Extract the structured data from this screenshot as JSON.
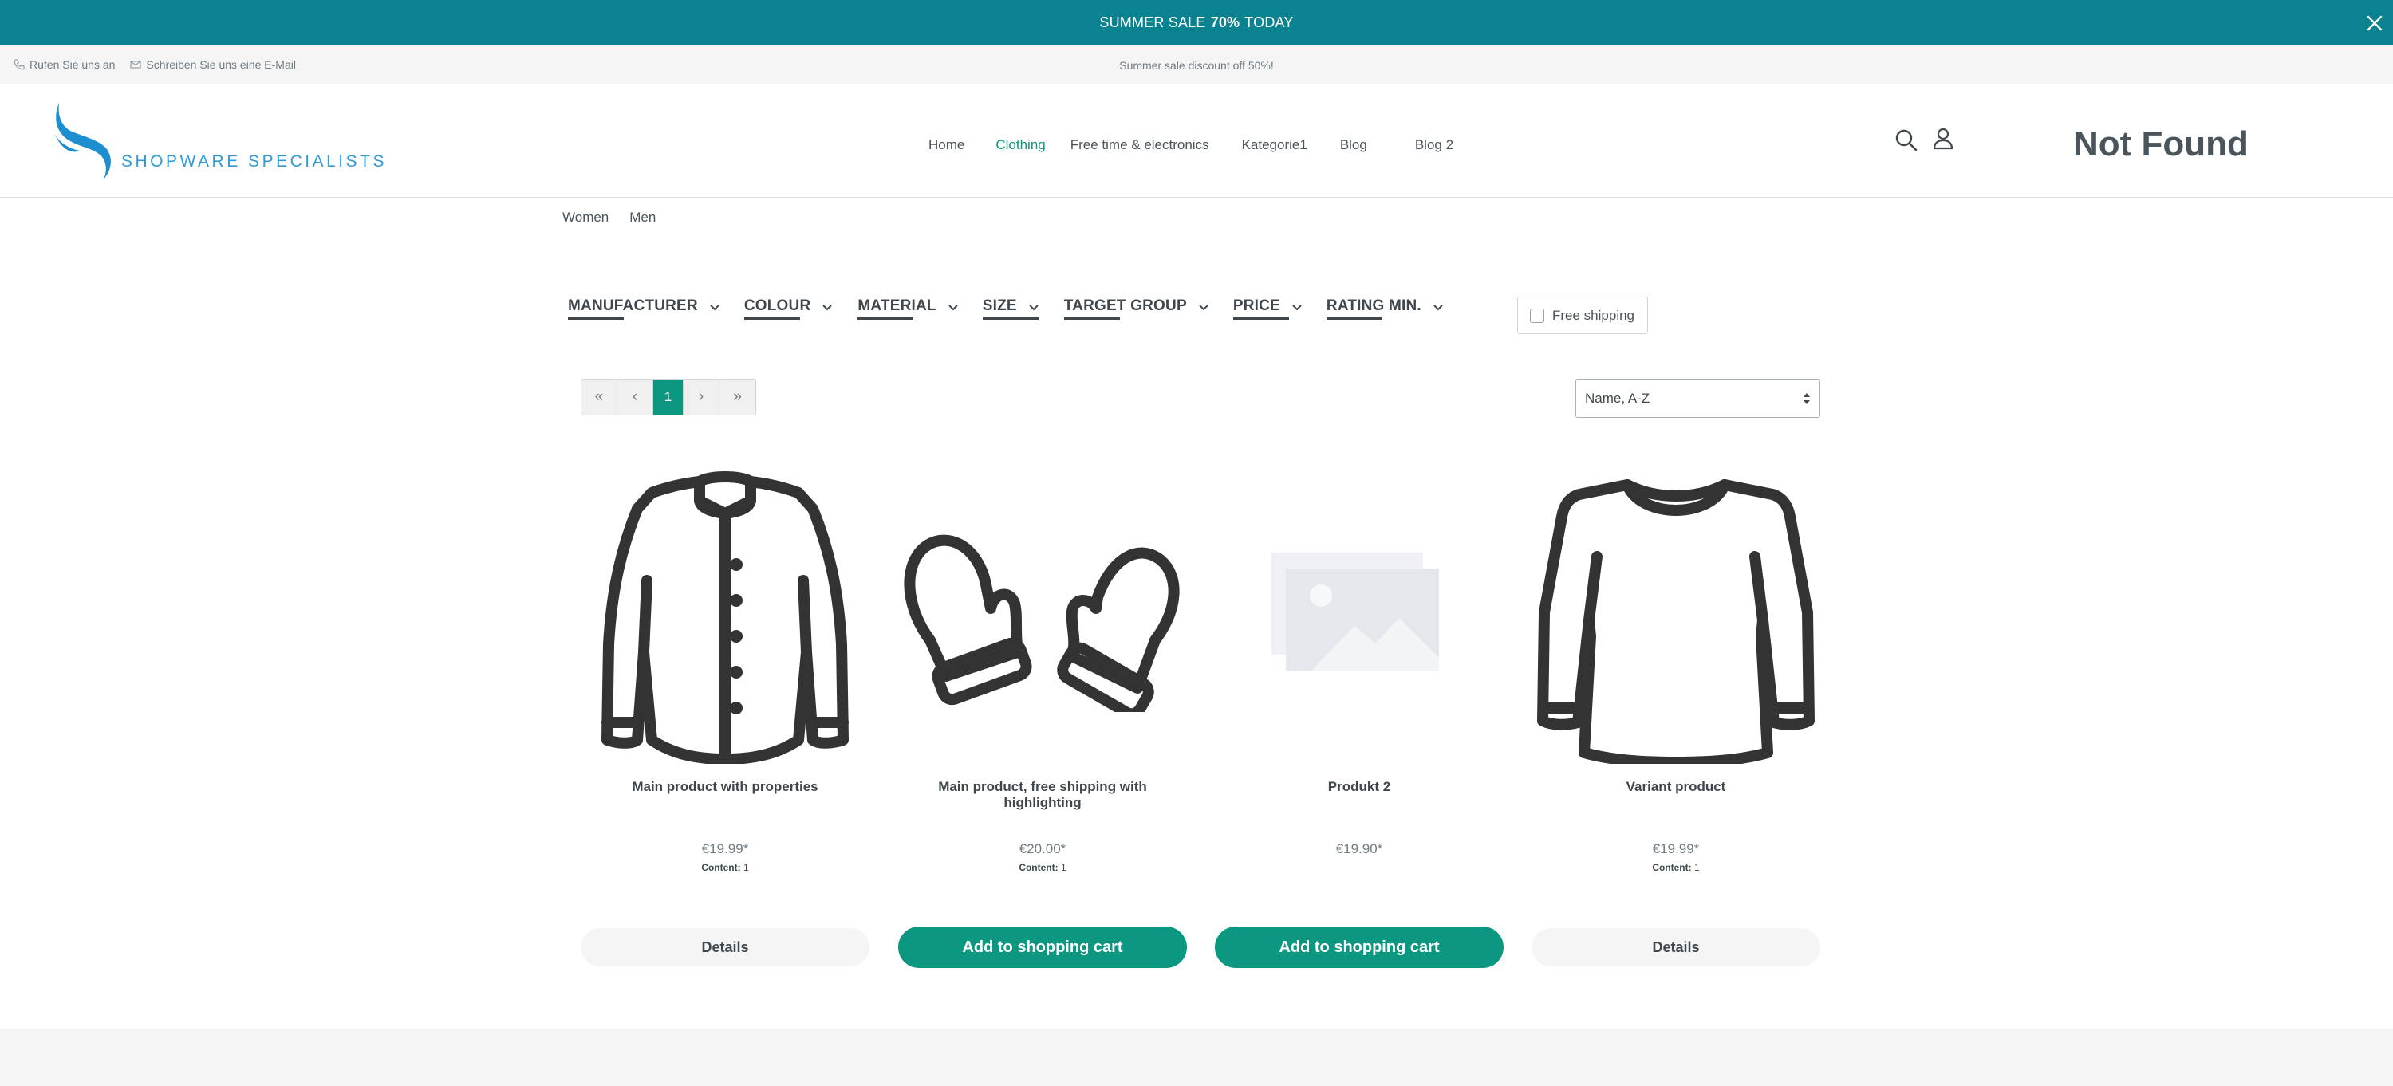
{
  "promo": {
    "text_before": "SUMMER SALE",
    "highlight": "70%",
    "text_after": "TODAY",
    "close_icon": "close-icon"
  },
  "topbar": {
    "phone_label": "Rufen Sie uns an",
    "email_label": "Schreiben Sie uns eine E-Mail",
    "notice": "Summer sale discount off 50%!"
  },
  "header": {
    "logo_text": "SHOPWARE SPECIALISTS",
    "not_found": "Not Found"
  },
  "nav": {
    "items": [
      {
        "label": "Home",
        "active": false
      },
      {
        "label": "Clothing",
        "active": true
      },
      {
        "label": "Free time & electronics",
        "active": false
      },
      {
        "label": "Kategorie1",
        "active": false
      },
      {
        "label": "Blog",
        "active": false
      },
      {
        "label": "Blog 2",
        "active": false
      }
    ]
  },
  "subnav": {
    "items": [
      "Women",
      "Men"
    ]
  },
  "filters": {
    "items": [
      "MANUFACTURER",
      "COLOUR",
      "MATERIAL",
      "SIZE",
      "TARGET GROUP",
      "PRICE",
      "RATING MIN."
    ],
    "free_shipping": "Free shipping"
  },
  "pagination": {
    "first": "«",
    "prev": "‹",
    "current": "1",
    "next": "›",
    "last": "»"
  },
  "sort": {
    "selected": "Name, A-Z"
  },
  "products": [
    {
      "name": "Main product with properties",
      "price": "€19.99*",
      "content_label": "Content:",
      "content_value": "1",
      "button": "Details",
      "button_type": "details",
      "image": "jacket-icon"
    },
    {
      "name": "Main product, free shipping with highlighting",
      "price": "€20.00*",
      "content_label": "Content:",
      "content_value": "1",
      "button": "Add to shopping cart",
      "button_type": "cart",
      "image": "mittens-icon"
    },
    {
      "name": "Produkt 2",
      "price": "€19.90*",
      "content_label": "",
      "content_value": "",
      "button": "Add to shopping cart",
      "button_type": "cart",
      "image": "placeholder-image-icon"
    },
    {
      "name": "Variant product",
      "price": "€19.99*",
      "content_label": "Content:",
      "content_value": "1",
      "button": "Details",
      "button_type": "details",
      "image": "longsleeve-icon"
    }
  ],
  "colors": {
    "promo_bg": "#0b8290",
    "accent": "#0b9780",
    "logo_blue": "#2f9bd6",
    "text": "#4a545b"
  }
}
